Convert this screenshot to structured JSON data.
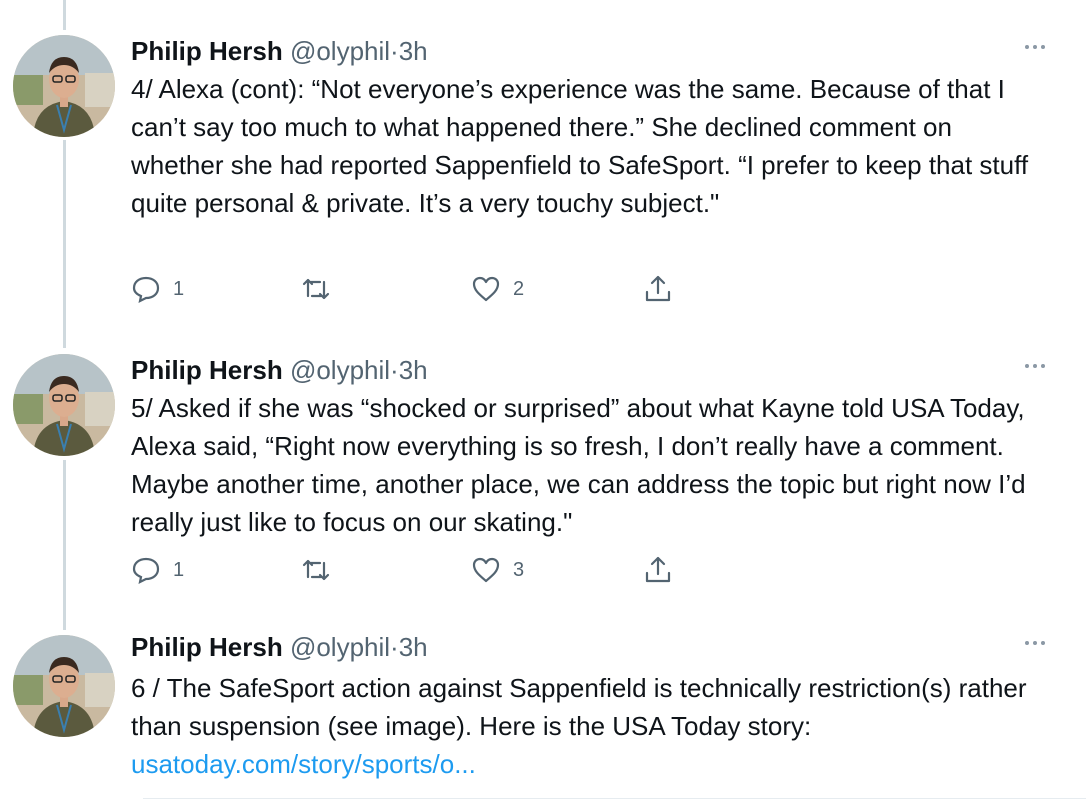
{
  "tweets": [
    {
      "author": "Philip Hersh",
      "handle": "@olyphil",
      "separator": "·",
      "time": "3h",
      "text": "4/ Alexa (cont): “Not everyone’s experience was the same. Because of that I can’t say too much to what happened there.” She declined comment on whether she had reported Sappenfield to SafeSport.  “I prefer to keep that stuff quite personal & private.  It’s a very touchy subject.\"",
      "reply_count": "1",
      "retweet_count": "",
      "like_count": "2"
    },
    {
      "author": "Philip Hersh",
      "handle": "@olyphil",
      "separator": "·",
      "time": "3h",
      "text": "5/ Asked if she was “shocked or surprised” about what Kayne told USA Today, Alexa said, “Right now everything is so fresh, I don’t really have a comment.  Maybe another time, another place, we can address the topic but right now I’d really just like to focus on our skating.\"",
      "reply_count": "1",
      "retweet_count": "",
      "like_count": "3"
    },
    {
      "author": "Philip Hersh",
      "handle": "@olyphil",
      "separator": "·",
      "time": "3h",
      "text": "6 / The SafeSport action against Sappenfield is technically restriction(s) rather than suspension (see image).  Here is the USA Today story:",
      "link": "usatoday.com/story/sports/o..."
    }
  ],
  "icons": {
    "more": "more-horizontal-icon",
    "reply": "reply-icon",
    "retweet": "retweet-icon",
    "like": "heart-icon",
    "share": "share-icon"
  },
  "colors": {
    "text": "#0f1419",
    "muted": "#536471",
    "link": "#1d9bf0",
    "thread_line": "#cfd9de"
  }
}
